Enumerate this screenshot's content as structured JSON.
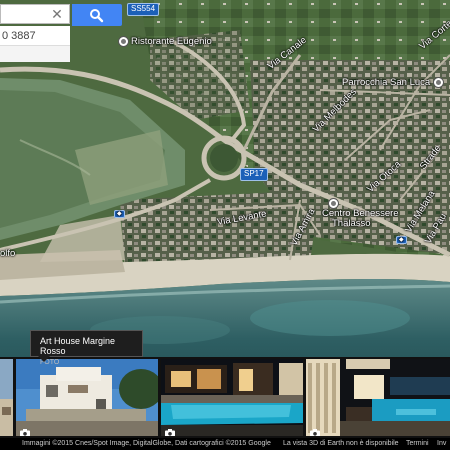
{
  "search": {
    "input_value": "",
    "clear_icon": "close-icon",
    "search_icon": "search-icon",
    "result_text": "0 3887"
  },
  "map": {
    "labels": {
      "road_ss554": "SS554",
      "ristorante": "Ristorante Eugenio",
      "via_canale": "Via Canale",
      "via_cortese": "Via Corte",
      "parrocchia": "Parrocchia San Luca",
      "via_melbodes": "Via Melbodes",
      "strade": "Strade",
      "via_otoca": "Via Otoca",
      "via_levante": "Via Levante",
      "sp17": "SP17",
      "via_mira": "Via Amira",
      "centro1": "Centro Benessere",
      "centro2": "Thalasso",
      "via_melana": "Via Melana",
      "via_pau": "Via Pau",
      "golfo": "olfo"
    }
  },
  "photos": {
    "tooltip_title": "Art House Margine Rosso",
    "tooltip_sub": "FOTO",
    "camera_icon": "camera-icon"
  },
  "footer": {
    "attribution": "Immagini ©2015 Cnes/Spot Image, DigitalGlobe, Dati cartografici ©2015 Google",
    "earth_note": "La vista 3D di Earth non è disponibile",
    "terms": "Termini",
    "help": "Inv"
  }
}
